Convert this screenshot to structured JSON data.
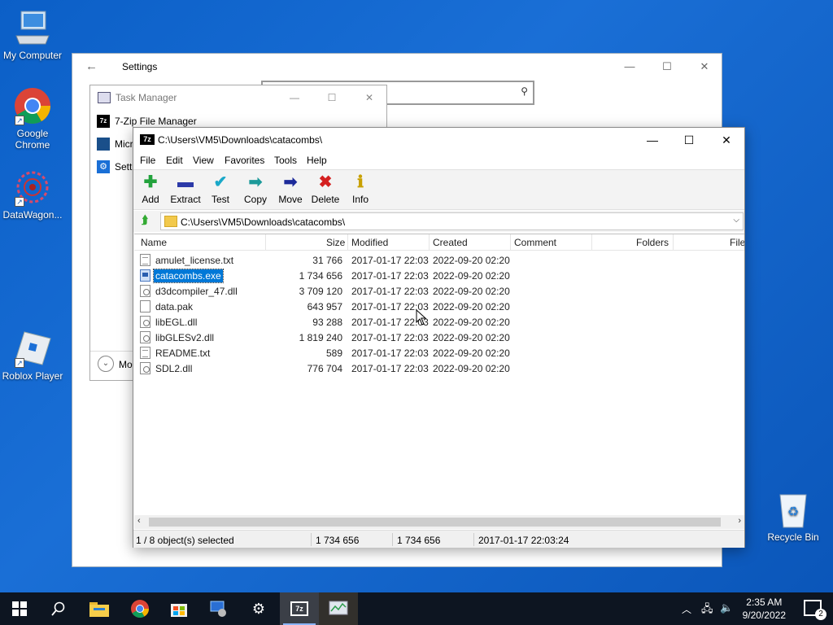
{
  "desktop": {
    "icons": [
      {
        "label": "My Computer"
      },
      {
        "label": "Google Chrome"
      },
      {
        "label": "DataWagon..."
      },
      {
        "label": "Roblox Player"
      },
      {
        "label": "Recycle Bin"
      }
    ]
  },
  "settings": {
    "title": "Settings",
    "back_glyph": "←",
    "search_glyph": "⚲"
  },
  "taskmgr": {
    "title": "Task Manager",
    "items": [
      {
        "label": "7-Zip File Manager"
      },
      {
        "label": "Micro"
      },
      {
        "label": "Setti"
      }
    ],
    "more_label": "Mo"
  },
  "zip": {
    "title": "C:\\Users\\VM5\\Downloads\\catacombs\\",
    "menu": [
      "File",
      "Edit",
      "View",
      "Favorites",
      "Tools",
      "Help"
    ],
    "toolbar": [
      {
        "label": "Add",
        "glyph": "✚",
        "color": "#22a23c"
      },
      {
        "label": "Extract",
        "glyph": "▬",
        "color": "#2c3aa8"
      },
      {
        "label": "Test",
        "glyph": "✔",
        "color": "#1aa8c8"
      },
      {
        "label": "Copy",
        "glyph": "➡",
        "color": "#1c9a9a"
      },
      {
        "label": "Move",
        "glyph": "➡",
        "color": "#1c2a9a"
      },
      {
        "label": "Delete",
        "glyph": "✖",
        "color": "#d42020"
      },
      {
        "label": "Info",
        "glyph": "ℹ",
        "color": "#c8a000"
      }
    ],
    "path": "C:\\Users\\VM5\\Downloads\\catacombs\\",
    "columns": [
      "Name",
      "Size",
      "Modified",
      "Created",
      "Comment",
      "Folders",
      "File"
    ],
    "files": [
      {
        "name": "amulet_license.txt",
        "size": "31 766",
        "modified": "2017-01-17 22:03",
        "created": "2022-09-20 02:20",
        "type": "txt"
      },
      {
        "name": "catacombs.exe",
        "size": "1 734 656",
        "modified": "2017-01-17 22:03",
        "created": "2022-09-20 02:20",
        "type": "exe",
        "selected": true
      },
      {
        "name": "d3dcompiler_47.dll",
        "size": "3 709 120",
        "modified": "2017-01-17 22:03",
        "created": "2022-09-20 02:20",
        "type": "dll"
      },
      {
        "name": "data.pak",
        "size": "643 957",
        "modified": "2017-01-17 22:03",
        "created": "2022-09-20 02:20",
        "type": "pak"
      },
      {
        "name": "libEGL.dll",
        "size": "93 288",
        "modified": "2017-01-17 22:03",
        "created": "2022-09-20 02:20",
        "type": "dll"
      },
      {
        "name": "libGLESv2.dll",
        "size": "1 819 240",
        "modified": "2017-01-17 22:03",
        "created": "2022-09-20 02:20",
        "type": "dll"
      },
      {
        "name": "README.txt",
        "size": "589",
        "modified": "2017-01-17 22:03",
        "created": "2022-09-20 02:20",
        "type": "txt"
      },
      {
        "name": "SDL2.dll",
        "size": "776 704",
        "modified": "2017-01-17 22:03",
        "created": "2022-09-20 02:20",
        "type": "dll"
      }
    ],
    "status": {
      "selected": "1 / 8 object(s) selected",
      "size": "1 734 656",
      "packed": "1 734 656",
      "date": "2017-01-17 22:03:24"
    }
  },
  "taskbar": {
    "time": "2:35 AM",
    "date": "9/20/2022",
    "notifications": "2"
  }
}
